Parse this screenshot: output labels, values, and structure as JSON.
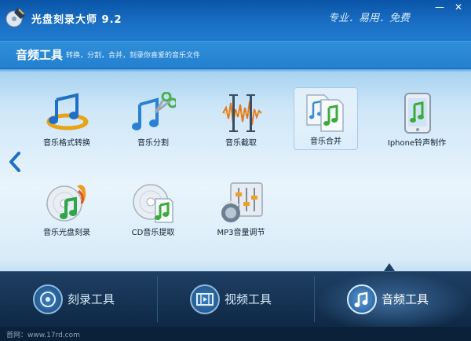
{
  "window": {
    "title": "光盘刻录大师 9.2",
    "slogan": "专业．易用．免费",
    "controls": {
      "minimize": "—",
      "close": "✕"
    }
  },
  "section": {
    "title": "音频工具",
    "subtitle": "转换，分割，合并，刻录你喜爱的音乐文件"
  },
  "tools": [
    {
      "label": "音乐格式转换",
      "icon": "music-convert-icon",
      "selected": false
    },
    {
      "label": "音乐分割",
      "icon": "music-split-icon",
      "selected": false
    },
    {
      "label": "音乐截取",
      "icon": "audio-waveform-trim-icon",
      "selected": false
    },
    {
      "label": "音乐合并",
      "icon": "music-merge-icon",
      "selected": true
    },
    {
      "label": "Iphone铃声制作",
      "icon": "iphone-ringtone-icon",
      "selected": false
    },
    {
      "label": "音乐光盘刻录",
      "icon": "music-disc-burn-icon",
      "selected": false
    },
    {
      "label": "CD音乐提取",
      "icon": "cd-rip-icon",
      "selected": false
    },
    {
      "label": "MP3音量调节",
      "icon": "volume-mixer-icon",
      "selected": false
    }
  ],
  "bottom_nav": [
    {
      "label": "刻录工具",
      "icon": "disc-burn-icon",
      "active": false
    },
    {
      "label": "视频工具",
      "icon": "film-icon",
      "active": false
    },
    {
      "label": "音频工具",
      "icon": "music-note-icon",
      "active": true
    }
  ],
  "footer": {
    "site": "首网：www.17rd.com"
  },
  "colors": {
    "accent": "#1f7bce",
    "bottom_bar": "#1e3f63",
    "content_bg": "#e9f4fc"
  }
}
